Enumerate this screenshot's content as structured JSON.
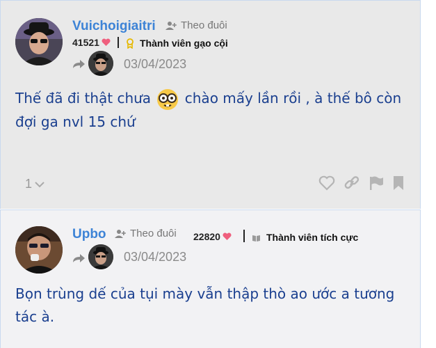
{
  "posts": [
    {
      "username": "Vuichoigiaitri",
      "follow_label": "Theo đuôi",
      "count": "41521",
      "rank": "Thành viên gạo cội",
      "date": "03/04/2023",
      "content_before": "Thế đã đi thật chưa ",
      "content_after": " chào mấy lần rồi , à thế bô còn đợi ga nvl 15 chứ",
      "likes": "1"
    },
    {
      "username": "Upbo",
      "follow_label": "Theo đuôi",
      "count": "22820",
      "rank": "Thành viên tích cực",
      "date": "03/04/2023",
      "content": "Bọn trùng dế của tụi mày vẫn thập thò ao ước a tương tác à."
    }
  ],
  "colors": {
    "username": "#3d83d6",
    "content": "#1a3f8f",
    "heart": "#ef5f7e",
    "badge_gold": "#e6b800",
    "icon_gray": "#b5b5b5"
  }
}
